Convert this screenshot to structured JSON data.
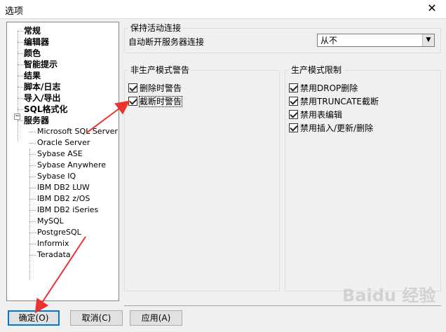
{
  "window": {
    "title": "选项",
    "close_glyph": "✕"
  },
  "tree": {
    "top_items": [
      "常规",
      "编辑器",
      "颜色",
      "智能提示",
      "结果",
      "脚本/日志",
      "导入/导出",
      "SQL格式化",
      "服务器"
    ],
    "expander_glyph": "−",
    "server_children": [
      "Microsoft SQL Server",
      "Oracle Server",
      "Sybase ASE",
      "Sybase Anywhere",
      "Sybase IQ",
      "IBM DB2 LUW",
      "IBM DB2 z/OS",
      "IBM DB2 iSeries",
      "MySQL",
      "PostgreSQL",
      "Informix",
      "Teradata"
    ]
  },
  "keepalive": {
    "group_label": "保持活动连接",
    "auto_disconnect_label": "自动断开服务器连接",
    "select_value": "从不"
  },
  "nonprod": {
    "group_label": "非生产模式警告",
    "items": [
      {
        "label": "删除时警告",
        "checked": true
      },
      {
        "label": "截断时警告",
        "checked": true
      }
    ]
  },
  "prod": {
    "group_label": "生产模式限制",
    "items": [
      {
        "label": "禁用DROP删除",
        "checked": true
      },
      {
        "label": "禁用TRUNCATE截断",
        "checked": true
      },
      {
        "label": "禁用表编辑",
        "checked": true
      },
      {
        "label": "禁用插入/更新/删除",
        "checked": true
      }
    ]
  },
  "buttons": {
    "ok": "确定(O)",
    "cancel": "取消(C)",
    "apply": "应用(A)"
  },
  "watermark": "Baidu 经验",
  "colors": {
    "annotation_arrow": "#e8342d",
    "default_button_border": "#0078d7"
  }
}
